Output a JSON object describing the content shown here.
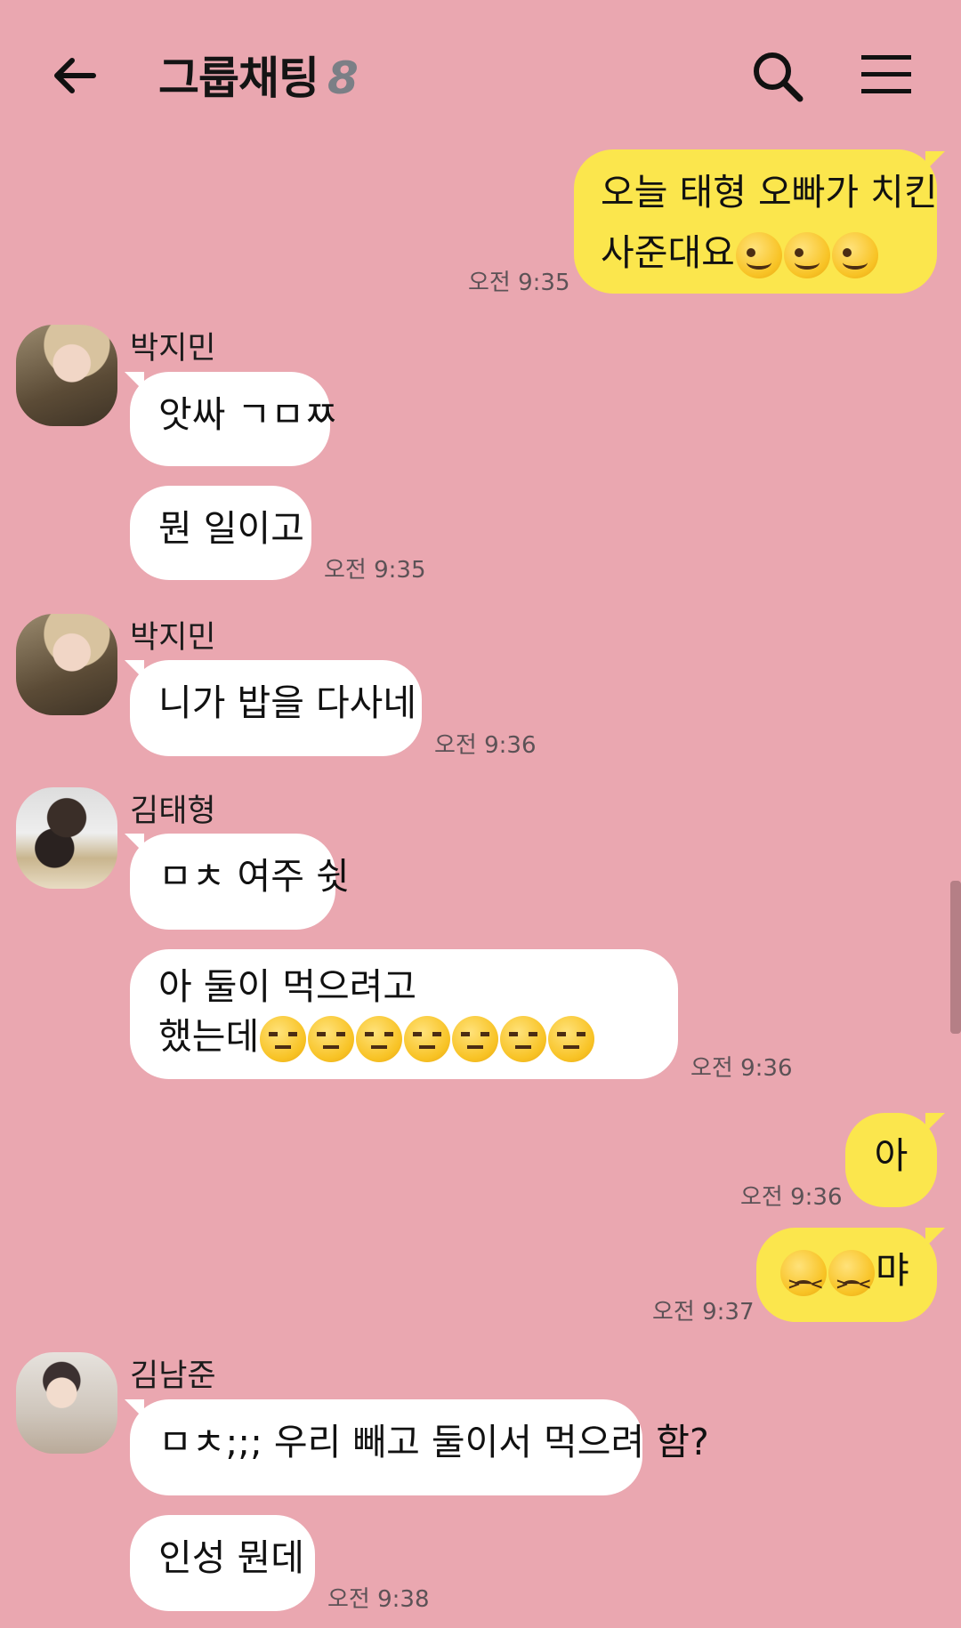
{
  "header": {
    "title": "그룹채팅",
    "member_count": "8"
  },
  "colors": {
    "background": "#eaa7b0",
    "outgoing_bubble": "#fbe64d",
    "incoming_bubble": "#ffffff"
  },
  "messages": [
    {
      "lines": [
        "오늘 태형 오빠가 치킨",
        "사준대요"
      ],
      "time": "오전 9:35"
    },
    {
      "sender": "박지민",
      "text": "앗싸 ㄱㅁㅉ"
    },
    {
      "text": "뭔 일이고",
      "time": "오전 9:35"
    },
    {
      "sender": "박지민",
      "text": "니가 밥을 다사네",
      "time": "오전 9:36"
    },
    {
      "sender": "김태형",
      "text": "ㅁㅊ 여주 쉿"
    },
    {
      "lines": [
        "아 둘이 먹으려고",
        "했는데"
      ],
      "time": "오전 9:36"
    },
    {
      "text": "아",
      "time": "오전 9:36"
    },
    {
      "text": "먀",
      "time": "오전 9:37"
    },
    {
      "sender": "김남준",
      "text": "ㅁㅊ;;; 우리 빼고 둘이서 먹으려 함?"
    },
    {
      "text": "인성 뭔데",
      "time": "오전 9:38"
    }
  ]
}
